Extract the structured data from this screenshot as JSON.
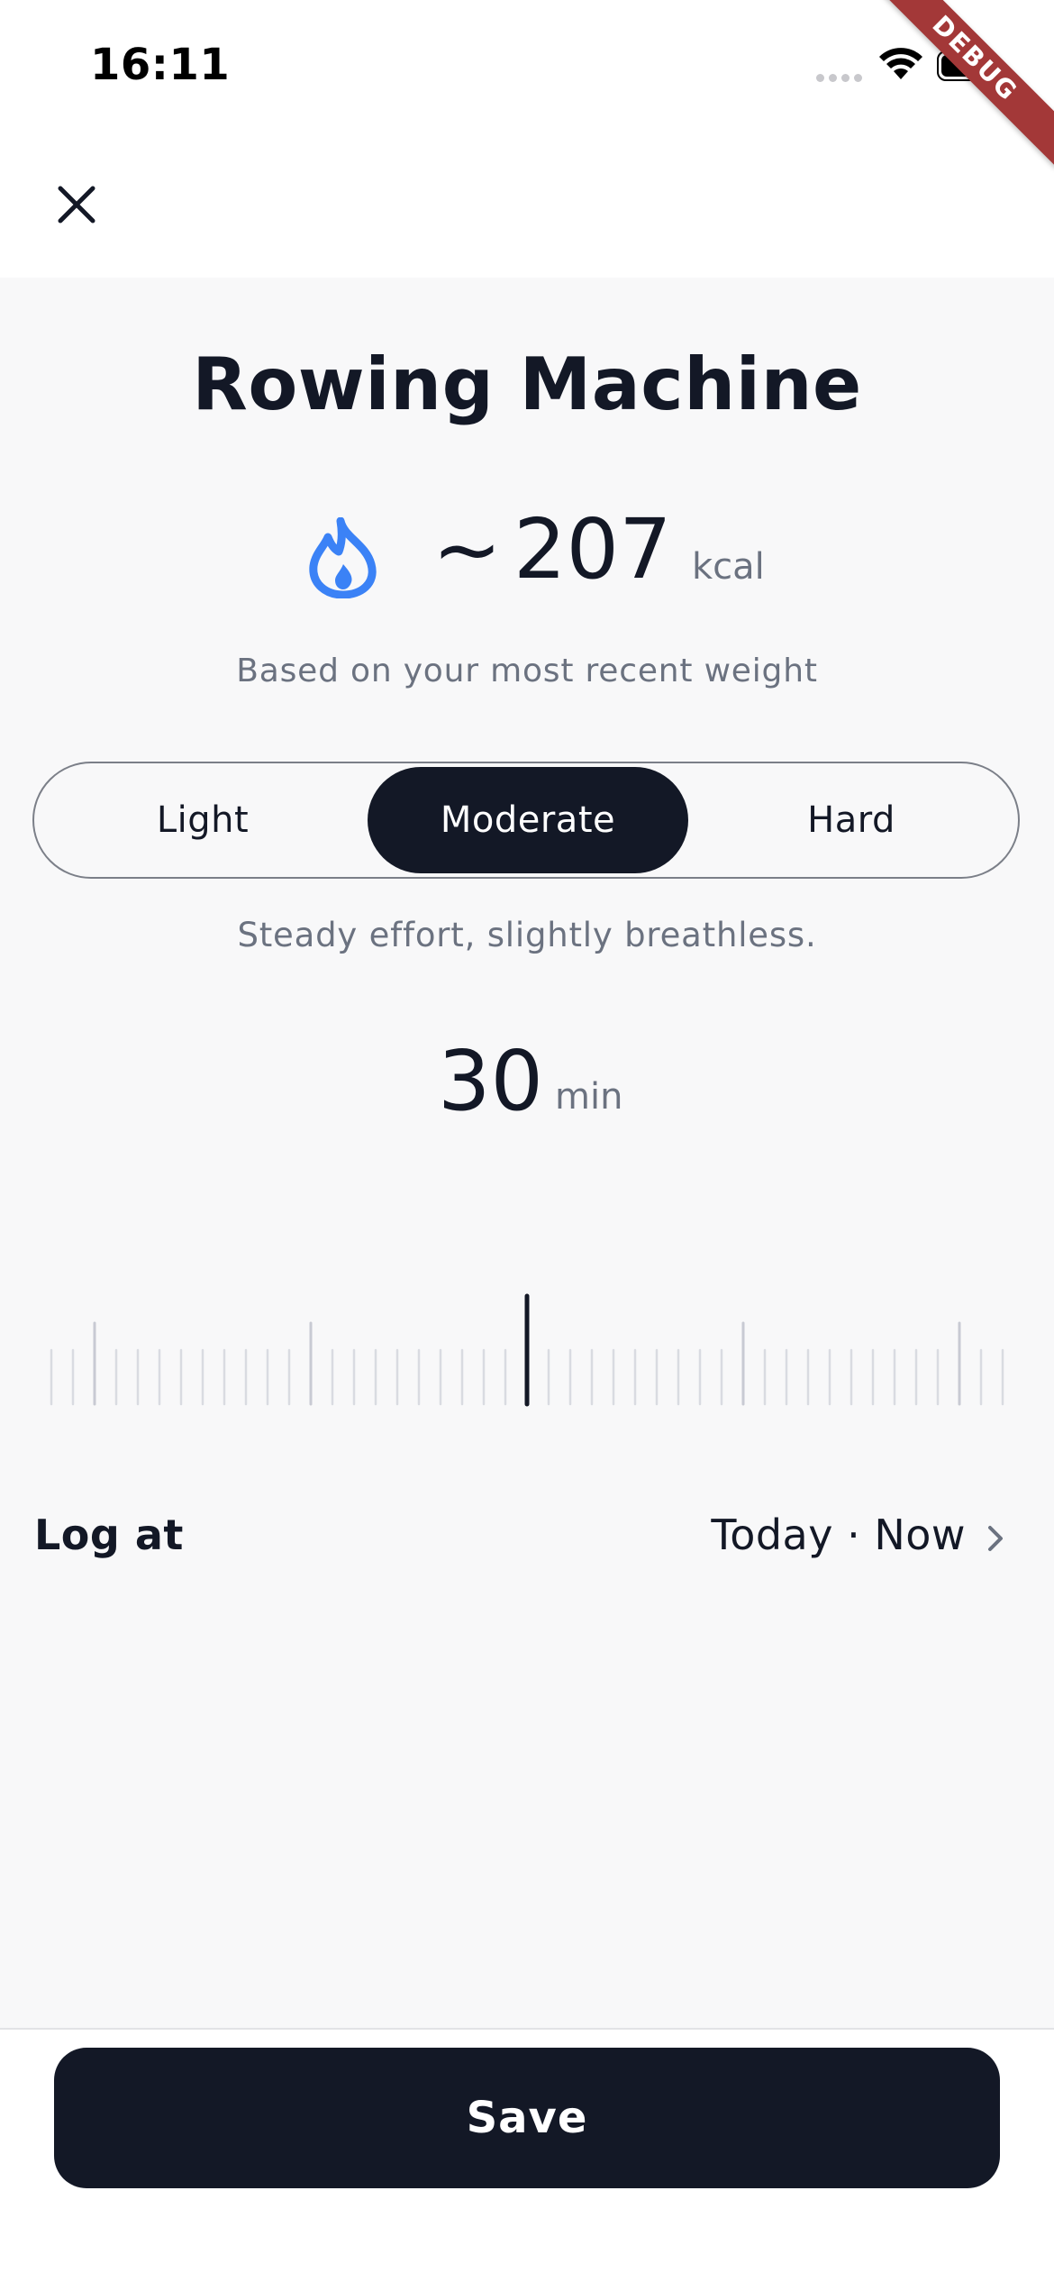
{
  "status_bar": {
    "time": "16:11"
  },
  "debug_banner": "DEBUG",
  "header": {
    "close_icon": "close-icon"
  },
  "activity": {
    "title": "Rowing Machine"
  },
  "calories": {
    "icon": "flame-icon",
    "approx_symbol": "~",
    "value": "207",
    "unit": "kcal",
    "note": "Based on your most recent weight",
    "accent_color": "#3b82f6"
  },
  "intensity": {
    "options": [
      "Light",
      "Moderate",
      "Hard"
    ],
    "selected": "Moderate",
    "description": "Steady effort, slightly breathless."
  },
  "duration": {
    "value": "30",
    "unit": "min",
    "slider_current": 30
  },
  "log_at": {
    "label": "Log at",
    "value": "Today · Now",
    "icon": "chevron-right-icon"
  },
  "actions": {
    "save_label": "Save"
  },
  "colors": {
    "primary_dark": "#131826",
    "muted_text": "#6b7280",
    "background": "#f8f8f9"
  }
}
